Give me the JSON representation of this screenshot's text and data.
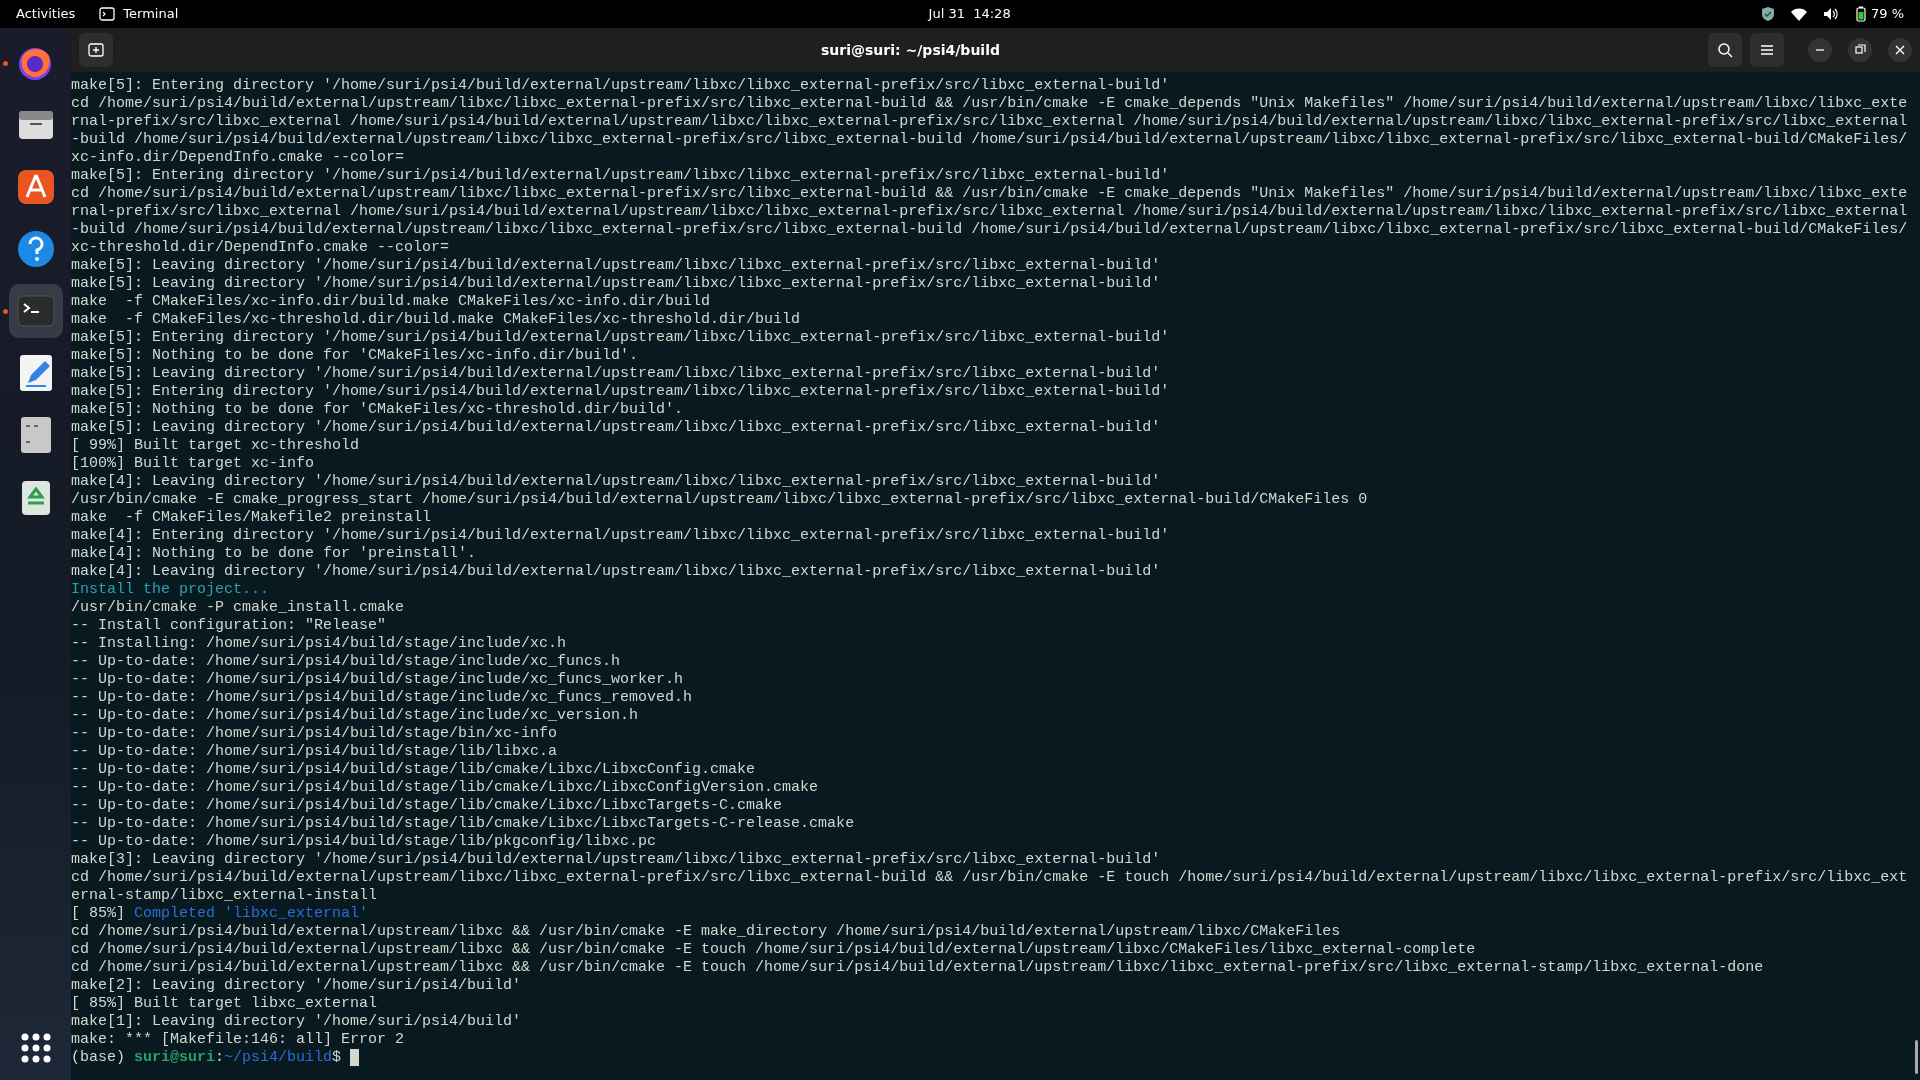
{
  "top_bar": {
    "activities": "Activities",
    "app": "Terminal",
    "clock": "Jul 31  14:28",
    "battery": "79 %"
  },
  "dock": {
    "items": [
      {
        "kind": "browser",
        "running": true,
        "selected": false
      },
      {
        "kind": "files",
        "running": false,
        "selected": false
      },
      {
        "kind": "store",
        "running": false,
        "selected": false
      },
      {
        "kind": "help",
        "running": false,
        "selected": false
      },
      {
        "kind": "terminal",
        "running": true,
        "selected": true
      },
      {
        "kind": "editor",
        "running": false,
        "selected": false
      },
      {
        "kind": "disk",
        "running": false,
        "selected": false
      },
      {
        "kind": "trash",
        "running": false,
        "selected": false
      }
    ]
  },
  "window": {
    "title": "suri@suri: ~/psi4/build"
  },
  "terminal": {
    "cursor": true,
    "lines": [
      {
        "text": "make[5]: Entering directory '/home/suri/psi4/build/external/upstream/libxc/libxc_external-prefix/src/libxc_external-build'"
      },
      {
        "text": "cd /home/suri/psi4/build/external/upstream/libxc/libxc_external-prefix/src/libxc_external-build && /usr/bin/cmake -E cmake_depends \"Unix Makefiles\" /home/suri/psi4/build/external/upstream/libxc/libxc_exte"
      },
      {
        "text": "rnal-prefix/src/libxc_external /home/suri/psi4/build/external/upstream/libxc/libxc_external-prefix/src/libxc_external /home/suri/psi4/build/external/upstream/libxc/libxc_external-prefix/src/libxc_external"
      },
      {
        "text": "-build /home/suri/psi4/build/external/upstream/libxc/libxc_external-prefix/src/libxc_external-build /home/suri/psi4/build/external/upstream/libxc/libxc_external-prefix/src/libxc_external-build/CMakeFiles/"
      },
      {
        "text": "xc-info.dir/DependInfo.cmake --color="
      },
      {
        "text": "make[5]: Entering directory '/home/suri/psi4/build/external/upstream/libxc/libxc_external-prefix/src/libxc_external-build'"
      },
      {
        "text": "cd /home/suri/psi4/build/external/upstream/libxc/libxc_external-prefix/src/libxc_external-build && /usr/bin/cmake -E cmake_depends \"Unix Makefiles\" /home/suri/psi4/build/external/upstream/libxc/libxc_exte"
      },
      {
        "text": "rnal-prefix/src/libxc_external /home/suri/psi4/build/external/upstream/libxc/libxc_external-prefix/src/libxc_external /home/suri/psi4/build/external/upstream/libxc/libxc_external-prefix/src/libxc_external"
      },
      {
        "text": "-build /home/suri/psi4/build/external/upstream/libxc/libxc_external-prefix/src/libxc_external-build /home/suri/psi4/build/external/upstream/libxc/libxc_external-prefix/src/libxc_external-build/CMakeFiles/"
      },
      {
        "text": "xc-threshold.dir/DependInfo.cmake --color="
      },
      {
        "text": "make[5]: Leaving directory '/home/suri/psi4/build/external/upstream/libxc/libxc_external-prefix/src/libxc_external-build'"
      },
      {
        "text": "make[5]: Leaving directory '/home/suri/psi4/build/external/upstream/libxc/libxc_external-prefix/src/libxc_external-build'"
      },
      {
        "text": "make  -f CMakeFiles/xc-info.dir/build.make CMakeFiles/xc-info.dir/build"
      },
      {
        "text": "make  -f CMakeFiles/xc-threshold.dir/build.make CMakeFiles/xc-threshold.dir/build"
      },
      {
        "text": "make[5]: Entering directory '/home/suri/psi4/build/external/upstream/libxc/libxc_external-prefix/src/libxc_external-build'"
      },
      {
        "text": "make[5]: Nothing to be done for 'CMakeFiles/xc-info.dir/build'."
      },
      {
        "text": "make[5]: Leaving directory '/home/suri/psi4/build/external/upstream/libxc/libxc_external-prefix/src/libxc_external-build'"
      },
      {
        "text": "make[5]: Entering directory '/home/suri/psi4/build/external/upstream/libxc/libxc_external-prefix/src/libxc_external-build'"
      },
      {
        "text": "make[5]: Nothing to be done for 'CMakeFiles/xc-threshold.dir/build'."
      },
      {
        "text": "make[5]: Leaving directory '/home/suri/psi4/build/external/upstream/libxc/libxc_external-prefix/src/libxc_external-build'"
      },
      {
        "text": "[ 99%] Built target xc-threshold"
      },
      {
        "text": "[100%] Built target xc-info"
      },
      {
        "text": "make[4]: Leaving directory '/home/suri/psi4/build/external/upstream/libxc/libxc_external-prefix/src/libxc_external-build'"
      },
      {
        "text": "/usr/bin/cmake -E cmake_progress_start /home/suri/psi4/build/external/upstream/libxc/libxc_external-prefix/src/libxc_external-build/CMakeFiles 0"
      },
      {
        "text": "make  -f CMakeFiles/Makefile2 preinstall"
      },
      {
        "text": "make[4]: Entering directory '/home/suri/psi4/build/external/upstream/libxc/libxc_external-prefix/src/libxc_external-build'"
      },
      {
        "text": "make[4]: Nothing to be done for 'preinstall'."
      },
      {
        "text": "make[4]: Leaving directory '/home/suri/psi4/build/external/upstream/libxc/libxc_external-prefix/src/libxc_external-build'"
      },
      {
        "segments": [
          {
            "text": "Install the project...",
            "kind": "cyan"
          }
        ]
      },
      {
        "text": "/usr/bin/cmake -P cmake_install.cmake"
      },
      {
        "text": "-- Install configuration: \"Release\""
      },
      {
        "text": "-- Installing: /home/suri/psi4/build/stage/include/xc.h"
      },
      {
        "text": "-- Up-to-date: /home/suri/psi4/build/stage/include/xc_funcs.h"
      },
      {
        "text": "-- Up-to-date: /home/suri/psi4/build/stage/include/xc_funcs_worker.h"
      },
      {
        "text": "-- Up-to-date: /home/suri/psi4/build/stage/include/xc_funcs_removed.h"
      },
      {
        "text": "-- Up-to-date: /home/suri/psi4/build/stage/include/xc_version.h"
      },
      {
        "text": "-- Up-to-date: /home/suri/psi4/build/stage/bin/xc-info"
      },
      {
        "text": "-- Up-to-date: /home/suri/psi4/build/stage/lib/libxc.a"
      },
      {
        "text": "-- Up-to-date: /home/suri/psi4/build/stage/lib/cmake/Libxc/LibxcConfig.cmake"
      },
      {
        "text": "-- Up-to-date: /home/suri/psi4/build/stage/lib/cmake/Libxc/LibxcConfigVersion.cmake"
      },
      {
        "text": "-- Up-to-date: /home/suri/psi4/build/stage/lib/cmake/Libxc/LibxcTargets-C.cmake"
      },
      {
        "text": "-- Up-to-date: /home/suri/psi4/build/stage/lib/cmake/Libxc/LibxcTargets-C-release.cmake"
      },
      {
        "text": "-- Up-to-date: /home/suri/psi4/build/stage/lib/pkgconfig/libxc.pc"
      },
      {
        "text": "make[3]: Leaving directory '/home/suri/psi4/build/external/upstream/libxc/libxc_external-prefix/src/libxc_external-build'"
      },
      {
        "text": "cd /home/suri/psi4/build/external/upstream/libxc/libxc_external-prefix/src/libxc_external-build && /usr/bin/cmake -E touch /home/suri/psi4/build/external/upstream/libxc/libxc_external-prefix/src/libxc_ext"
      },
      {
        "text": "ernal-stamp/libxc_external-install"
      },
      {
        "segments": [
          {
            "text": "[ 85%] ",
            "kind": "plain"
          },
          {
            "text": "Completed 'libxc_external'",
            "kind": "blue"
          }
        ]
      },
      {
        "text": "cd /home/suri/psi4/build/external/upstream/libxc && /usr/bin/cmake -E make_directory /home/suri/psi4/build/external/upstream/libxc/CMakeFiles"
      },
      {
        "text": "cd /home/suri/psi4/build/external/upstream/libxc && /usr/bin/cmake -E touch /home/suri/psi4/build/external/upstream/libxc/CMakeFiles/libxc_external-complete"
      },
      {
        "text": "cd /home/suri/psi4/build/external/upstream/libxc && /usr/bin/cmake -E touch /home/suri/psi4/build/external/upstream/libxc/libxc_external-prefix/src/libxc_external-stamp/libxc_external-done"
      },
      {
        "text": "make[2]: Leaving directory '/home/suri/psi4/build'"
      },
      {
        "text": "[ 85%] Built target libxc_external"
      },
      {
        "text": "make[1]: Leaving directory '/home/suri/psi4/build'"
      },
      {
        "text": "make: *** [Makefile:146: all] Error 2"
      },
      {
        "segments": [
          {
            "text": "(base) ",
            "kind": "plain"
          },
          {
            "text": "suri@suri",
            "kind": "green"
          },
          {
            "text": ":",
            "kind": "plain"
          },
          {
            "text": "~/psi4/build",
            "kind": "blue"
          },
          {
            "text": "$ ",
            "kind": "plain"
          }
        ]
      }
    ]
  }
}
